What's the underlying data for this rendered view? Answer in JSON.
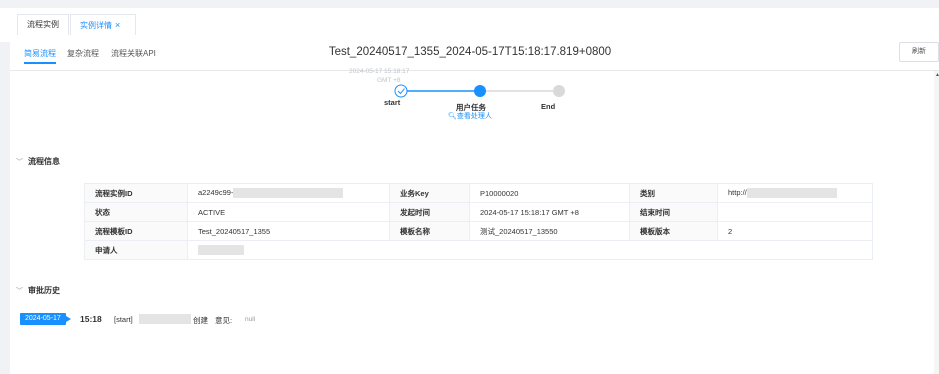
{
  "top_tabs": [
    {
      "label": "流程实例",
      "active": false
    },
    {
      "label": "实例详情",
      "active": true,
      "close": "×"
    }
  ],
  "sub_tabs": [
    {
      "label": "简易流程",
      "active": true
    },
    {
      "label": "复杂流程",
      "active": false
    },
    {
      "label": "流程关联API",
      "active": false
    }
  ],
  "refresh_label": "刷新",
  "flow": {
    "title": "Test_20240517_1355_2024-05-17T15:18:17.819+0800",
    "start_time": "2024-05-17 15:18:17",
    "start_time_zone": "GMT +8",
    "steps": [
      {
        "label": "start",
        "status": "done"
      },
      {
        "label": "用户任务",
        "status": "current",
        "link": "查看处理人"
      },
      {
        "label": "End",
        "status": "pending"
      }
    ]
  },
  "info_section": {
    "title": "流程信息",
    "rows": [
      [
        {
          "label": "流程实例ID",
          "value": "a2249c99-",
          "blurred": true
        },
        {
          "label": "业务Key",
          "value": "P10000020"
        },
        {
          "label": "类别",
          "value": "http://",
          "blurred": true
        }
      ],
      [
        {
          "label": "状态",
          "value": "ACTIVE"
        },
        {
          "label": "发起时间",
          "value": "2024-05-17 15:18:17 GMT +8"
        },
        {
          "label": "结束时间",
          "value": ""
        }
      ],
      [
        {
          "label": "流程模板ID",
          "value": "Test_20240517_1355"
        },
        {
          "label": "模板名称",
          "value": "测试_20240517_13550"
        },
        {
          "label": "模板版本",
          "value": "2"
        }
      ],
      [
        {
          "label": "申请人",
          "value": "",
          "blurred": true
        }
      ]
    ]
  },
  "history_section": {
    "title": "审批历史",
    "entries": [
      {
        "date": "2024-05-17",
        "time": "15:18",
        "node": "[start]",
        "action": "创建",
        "opinion_label": "意见:",
        "opinion": "null"
      }
    ]
  },
  "colors": {
    "accent": "#1890ff",
    "pending": "#d9d9d9",
    "background": "#f0f2f5"
  }
}
